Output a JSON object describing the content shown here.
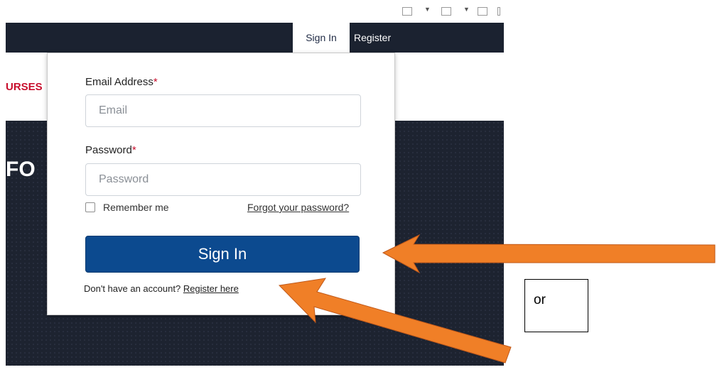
{
  "nav": {
    "signin": "Sign In",
    "register": "Register"
  },
  "page": {
    "courses_fragment": "URSES",
    "hero_fragment": "FO"
  },
  "login": {
    "email_label": "Email Address",
    "email_placeholder": "Email",
    "password_label": "Password",
    "password_placeholder": "Password",
    "required_mark": "*",
    "remember_label": "Remember me",
    "forgot_link": "Forgot your password?",
    "signin_button": "Sign In",
    "no_account_text": "Don't have an account? ",
    "register_link": "Register here"
  },
  "annotation": {
    "or_text": "or"
  },
  "colors": {
    "arrow": "#f07f27",
    "signin_button": "#0c4a8f",
    "nav_bg": "#1b2230",
    "accent_red": "#c8102e"
  }
}
